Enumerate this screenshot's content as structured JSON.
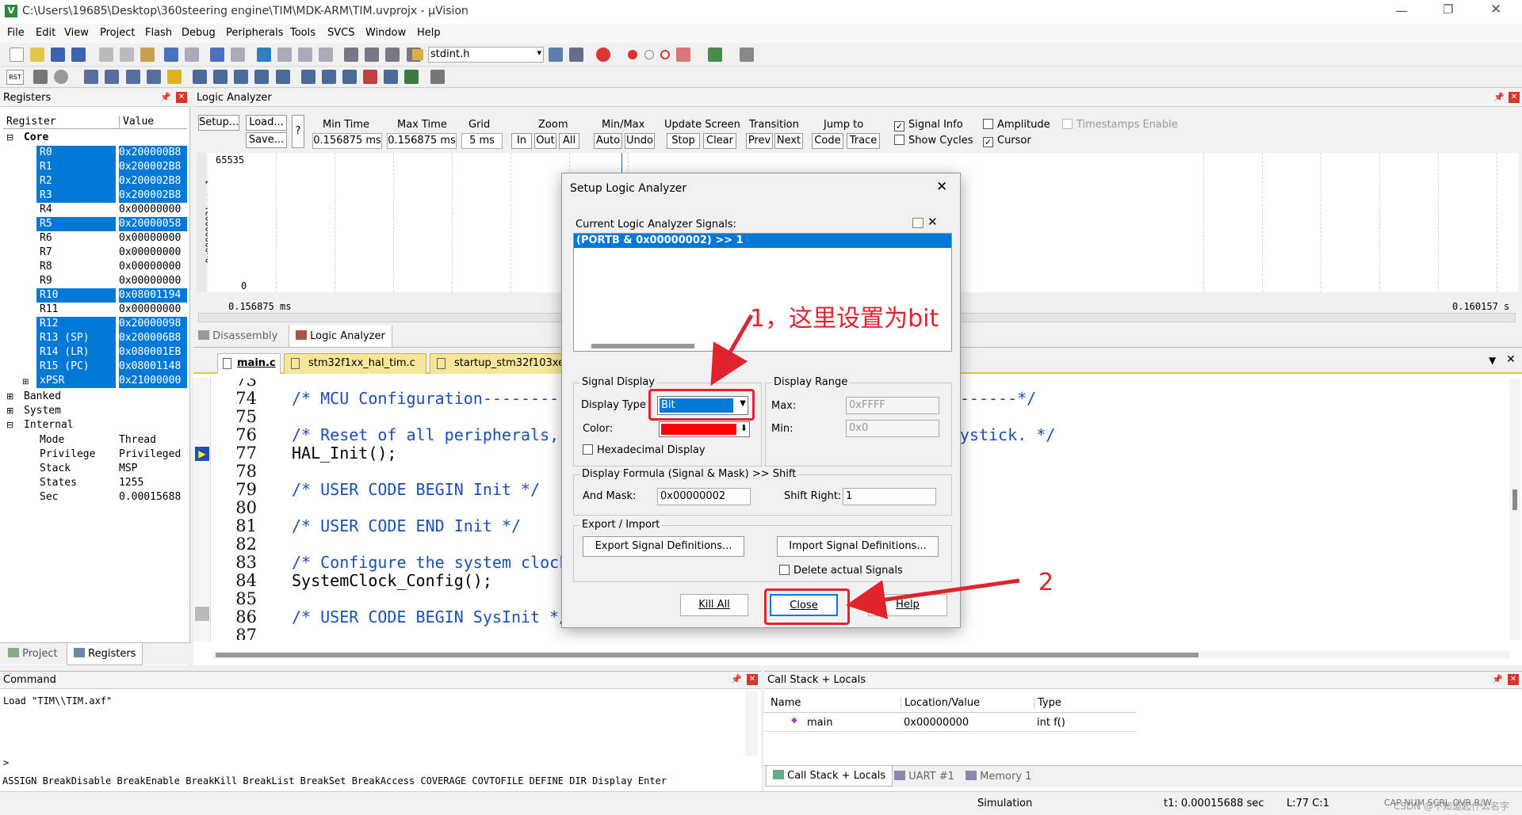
{
  "window": {
    "title": "C:\\Users\\19685\\Desktop\\360steering engine\\TIM\\MDK-ARM\\TIM.uvprojx - µVision"
  },
  "menu": [
    "File",
    "Edit",
    "View",
    "Project",
    "Flash",
    "Debug",
    "Peripherals",
    "Tools",
    "SVCS",
    "Window",
    "Help"
  ],
  "toolbar": {
    "file_combo": "stdint.h",
    "rst_label": "RST"
  },
  "registers": {
    "title": "Registers",
    "col_register": "Register",
    "col_value": "Value",
    "core_label": "Core",
    "rows": [
      {
        "name": "R0",
        "value": "0x200000B8",
        "selected": true
      },
      {
        "name": "R1",
        "value": "0x200002B8",
        "selected": true
      },
      {
        "name": "R2",
        "value": "0x200002B8",
        "selected": true
      },
      {
        "name": "R3",
        "value": "0x200002B8",
        "selected": true
      },
      {
        "name": "R4",
        "value": "0x00000000",
        "selected": false
      },
      {
        "name": "R5",
        "value": "0x20000058",
        "selected": true
      },
      {
        "name": "R6",
        "value": "0x00000000",
        "selected": false
      },
      {
        "name": "R7",
        "value": "0x00000000",
        "selected": false
      },
      {
        "name": "R8",
        "value": "0x00000000",
        "selected": false
      },
      {
        "name": "R9",
        "value": "0x00000000",
        "selected": false
      },
      {
        "name": "R10",
        "value": "0x08001194",
        "selected": true
      },
      {
        "name": "R11",
        "value": "0x00000000",
        "selected": false
      },
      {
        "name": "R12",
        "value": "0x20000098",
        "selected": true
      },
      {
        "name": "R13 (SP)",
        "value": "0x200006B8",
        "selected": true
      },
      {
        "name": "R14 (LR)",
        "value": "0x080001EB",
        "selected": true
      },
      {
        "name": "R15 (PC)",
        "value": "0x08001148",
        "selected": true
      },
      {
        "name": "xPSR",
        "value": "0x21000000",
        "selected": true
      }
    ],
    "groups": [
      "Banked",
      "System",
      "Internal"
    ],
    "internal": [
      {
        "name": "Mode",
        "value": "Thread"
      },
      {
        "name": "Privilege",
        "value": "Privileged"
      },
      {
        "name": "Stack",
        "value": "MSP"
      },
      {
        "name": "States",
        "value": "1255"
      },
      {
        "name": "Sec",
        "value": "0.00015688"
      }
    ],
    "tabs": [
      "Project",
      "Registers"
    ]
  },
  "logic_analyzer": {
    "title": "Logic Analyzer",
    "setup": "Setup...",
    "load": "Load...",
    "save": "Save...",
    "help": "?",
    "min_time_label": "Min Time",
    "min_time": "0.156875 ms",
    "max_time_label": "Max Time",
    "max_time": "0.156875 ms",
    "grid_label": "Grid",
    "grid": "5 ms",
    "zoom_label": "Zoom",
    "zoom_in": "In",
    "zoom_out": "Out",
    "zoom_all": "All",
    "minmax_label": "Min/Max",
    "auto": "Auto",
    "undo": "Undo",
    "update_label": "Update Screen",
    "stop": "Stop",
    "clear": "Clear",
    "transition_label": "Transition",
    "prev": "Prev",
    "next": "Next",
    "jump_label": "Jump to",
    "code": "Code",
    "trace": "Trace",
    "signal_info": "Signal Info",
    "show_cycles": "Show Cycles",
    "amplitude": "Amplitude",
    "cursor": "Cursor",
    "timestamps": "Timestamps Enable",
    "y_max": "65535",
    "y_min": "0",
    "signal_vertical": "0x00000002) >> 1",
    "time_left": "0.156875 ms",
    "time_right": "0.160157 s"
  },
  "view_tabs": [
    "Disassembly",
    "Logic Analyzer"
  ],
  "editor": {
    "tabs": [
      "main.c",
      "stm32f1xx_hal_tim.c",
      "startup_stm32f103xe"
    ],
    "lines": [
      {
        "n": "73",
        "text": ""
      },
      {
        "n": "74",
        "text": "/* MCU Configuration--------------------------------------------------------*/"
      },
      {
        "n": "75",
        "text": ""
      },
      {
        "n": "76",
        "text": "/* Reset of all peripherals, Initializes the Flash interface and the Systick. */"
      },
      {
        "n": "77",
        "text": "HAL_Init();"
      },
      {
        "n": "78",
        "text": ""
      },
      {
        "n": "79",
        "text": "/* USER CODE BEGIN Init */"
      },
      {
        "n": "80",
        "text": ""
      },
      {
        "n": "81",
        "text": "/* USER CODE END Init */"
      },
      {
        "n": "82",
        "text": ""
      },
      {
        "n": "83",
        "text": "/* Configure the system clock */"
      },
      {
        "n": "84",
        "text": "SystemClock_Config();"
      },
      {
        "n": "85",
        "text": ""
      },
      {
        "n": "86",
        "text": "/* USER CODE BEGIN SysInit */"
      },
      {
        "n": "87",
        "text": ""
      }
    ]
  },
  "dialog": {
    "title": "Setup Logic Analyzer",
    "signals_label": "Current Logic Analyzer Signals:",
    "signals": [
      "(PORTB & 0x00000002) >> 1"
    ],
    "signal_display": "Signal Display",
    "display_type_label": "Display Type",
    "display_type": "Bit",
    "color_label": "Color:",
    "color": "#ff0000",
    "hex_display": "Hexadecimal Display",
    "display_range": "Display Range",
    "max_label": "Max:",
    "max": "0xFFFF",
    "min_label": "Min:",
    "min": "0x0",
    "formula_label": "Display Formula (Signal & Mask) >> Shift",
    "and_mask_label": "And Mask:",
    "and_mask": "0x00000002",
    "shift_label": "Shift Right:",
    "shift": "1",
    "export_import": "Export / Import",
    "export": "Export Signal Definitions...",
    "import": "Import Signal Definitions...",
    "delete_actual": "Delete actual Signals",
    "kill_all": "Kill All",
    "close": "Close",
    "help": "Help"
  },
  "annotations": {
    "note1": "1，这里设置为bit",
    "note2": "2",
    "color": "#e0232c"
  },
  "command": {
    "title": "Command",
    "output": "Load \"TIM\\\\TIM.axf\"",
    "prompt": ">",
    "hints": "ASSIGN BreakDisable BreakEnable BreakKill BreakList BreakSet BreakAccess COVERAGE COVTOFILE DEFINE DIR Display Enter"
  },
  "callstack": {
    "title": "Call Stack + Locals",
    "col_name": "Name",
    "col_location": "Location/Value",
    "col_type": "Type",
    "rows": [
      {
        "name": "main",
        "location": "0x00000000",
        "type": "int f()"
      }
    ],
    "tabs": [
      "Call Stack + Locals",
      "UART #1",
      "Memory 1"
    ]
  },
  "status": {
    "mode": "Simulation",
    "time": "t1: 0.00015688 sec",
    "position": "L:77 C:1",
    "flags": "CAP NUM SCRL OVR R/W",
    "watermark": "CSDN @不知道起什么名字"
  }
}
